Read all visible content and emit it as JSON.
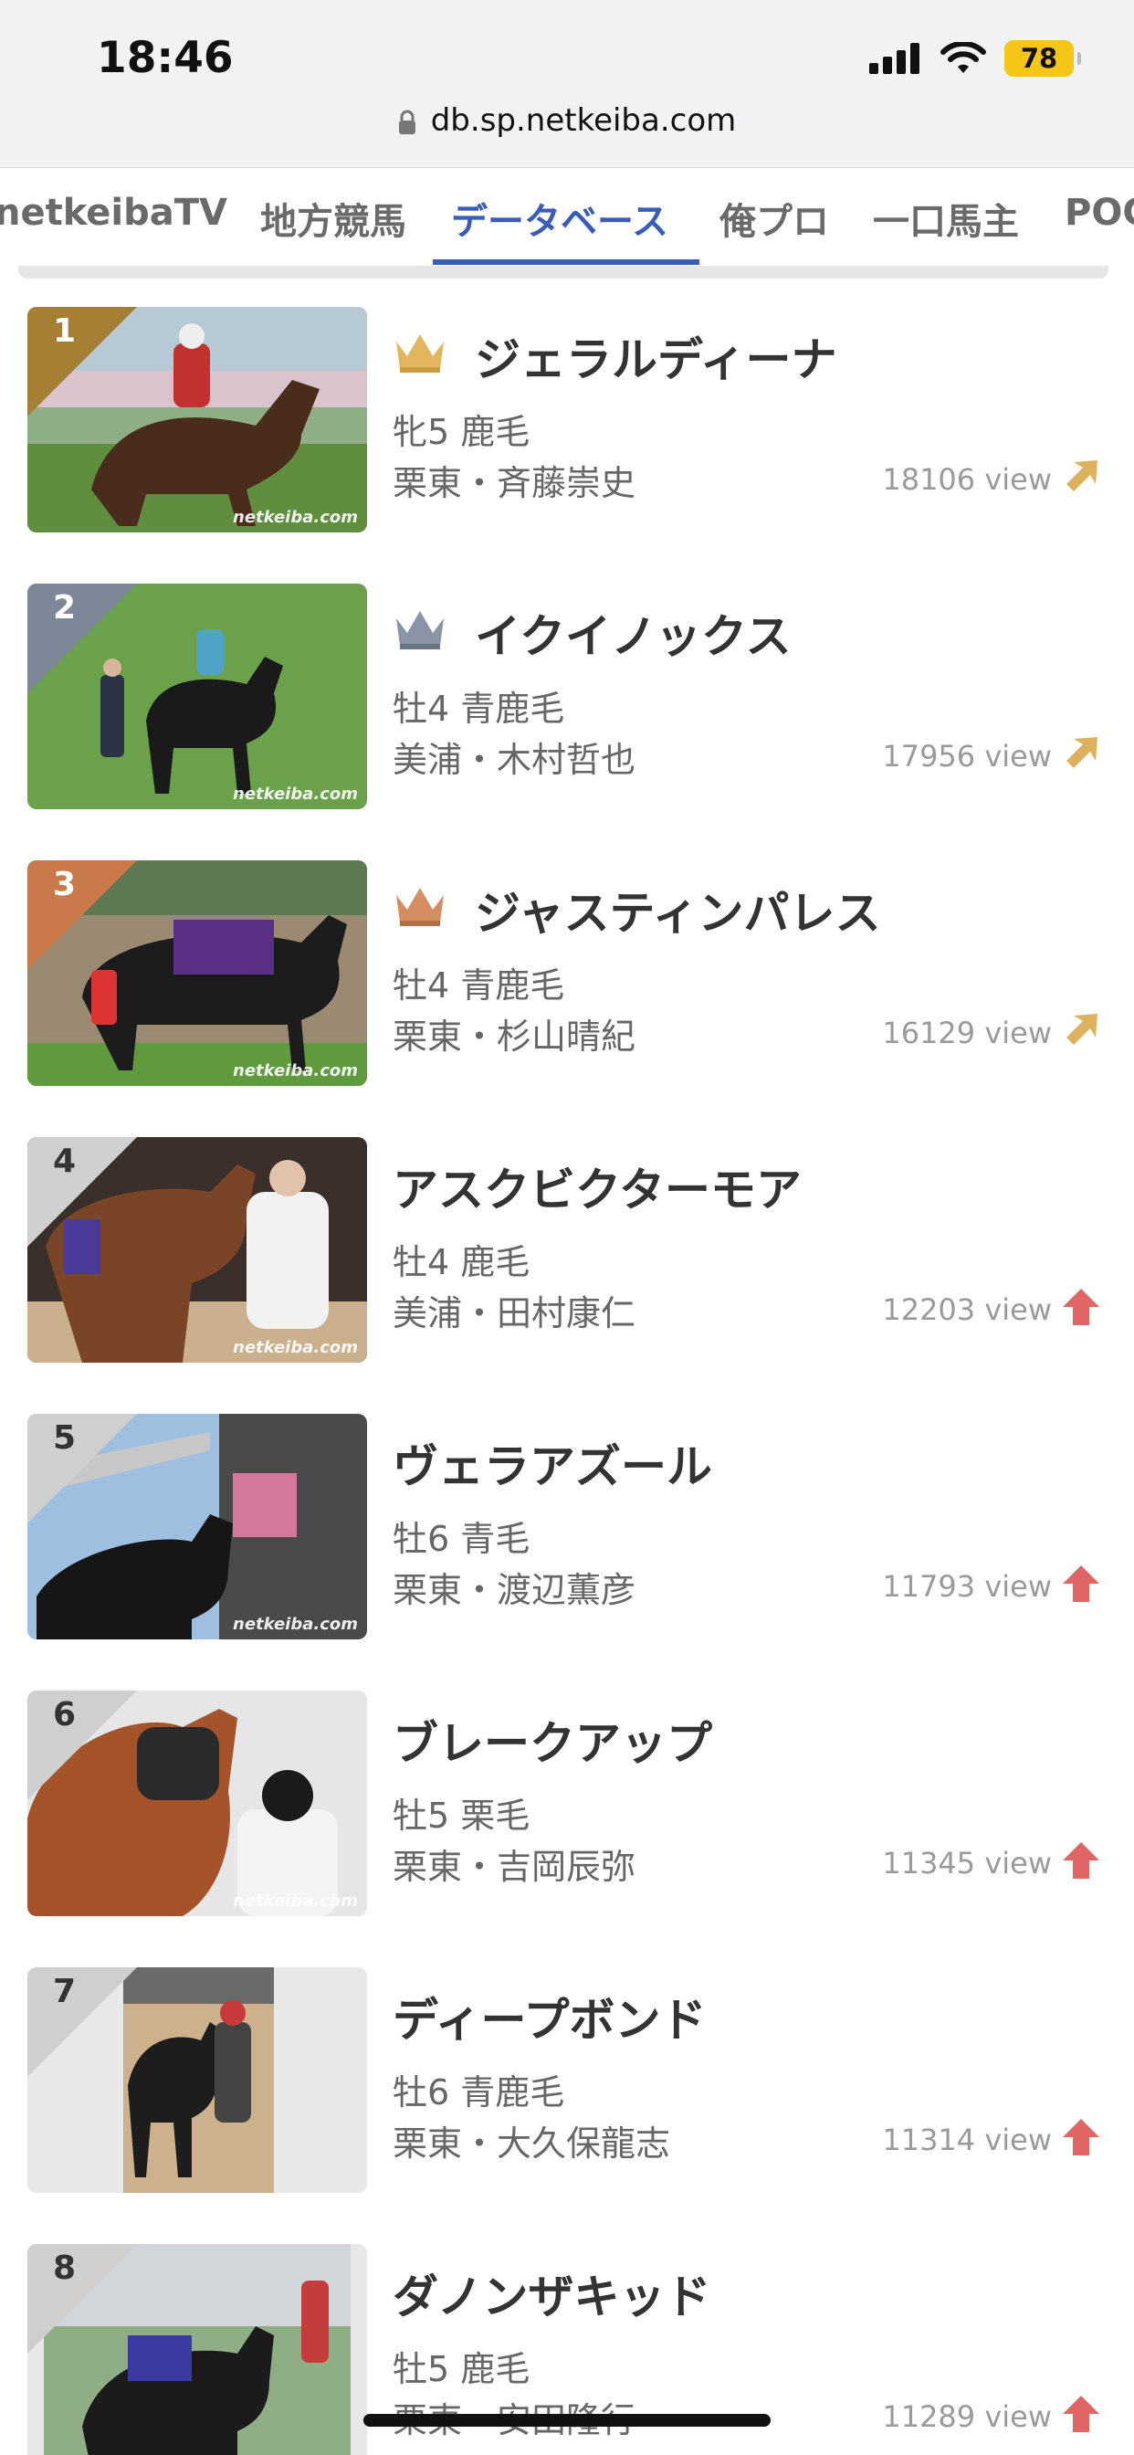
{
  "status_bar": {
    "time": "18:46",
    "battery": "78"
  },
  "browser": {
    "url": "db.sp.netkeiba.com"
  },
  "tabs": [
    "netkeibaTV",
    "地方競馬",
    "データベース",
    "俺プロ",
    "一口馬主",
    "POG"
  ],
  "active_tab": "データベース",
  "colors": {
    "accent": "#3b5bb8",
    "gold": "#a57f33",
    "silver": "#7d8797",
    "bronze": "#c9794a",
    "up_arrow": "#e06565",
    "diag_arrow": "#ddb15d"
  },
  "watermark": "netkeiba.com",
  "horses": [
    {
      "rank": "1",
      "name": "ジェラルディーナ",
      "sex_age_coat": "牝5 鹿毛",
      "trainer": "栗東・斉藤崇史",
      "views": "18106 view",
      "crown": "gold-crown-icon",
      "trend": "up-right-icon"
    },
    {
      "rank": "2",
      "name": "イクイノックス",
      "sex_age_coat": "牡4 青鹿毛",
      "trainer": "美浦・木村哲也",
      "views": "17956 view",
      "crown": "silver-crown-icon",
      "trend": "up-right-icon"
    },
    {
      "rank": "3",
      "name": "ジャスティンパレス",
      "sex_age_coat": "牡4 青鹿毛",
      "trainer": "栗東・杉山晴紀",
      "views": "16129 view",
      "crown": "bronze-crown-icon",
      "trend": "up-right-icon"
    },
    {
      "rank": "4",
      "name": "アスクビクターモア",
      "sex_age_coat": "牡4 鹿毛",
      "trainer": "美浦・田村康仁",
      "views": "12203 view",
      "crown": "",
      "trend": "up-icon"
    },
    {
      "rank": "5",
      "name": "ヴェラアズール",
      "sex_age_coat": "牡6 青毛",
      "trainer": "栗東・渡辺薫彦",
      "views": "11793 view",
      "crown": "",
      "trend": "up-icon"
    },
    {
      "rank": "6",
      "name": "ブレークアップ",
      "sex_age_coat": "牡5 栗毛",
      "trainer": "栗東・吉岡辰弥",
      "views": "11345 view",
      "crown": "",
      "trend": "up-icon"
    },
    {
      "rank": "7",
      "name": "ディープボンド",
      "sex_age_coat": "牡6 青鹿毛",
      "trainer": "栗東・大久保龍志",
      "views": "11314 view",
      "crown": "",
      "trend": "up-icon"
    },
    {
      "rank": "8",
      "name": "ダノンザキッド",
      "sex_age_coat": "牡5 鹿毛",
      "trainer": "栗東・安田隆行",
      "views": "11289 view",
      "crown": "",
      "trend": "up-icon"
    }
  ]
}
